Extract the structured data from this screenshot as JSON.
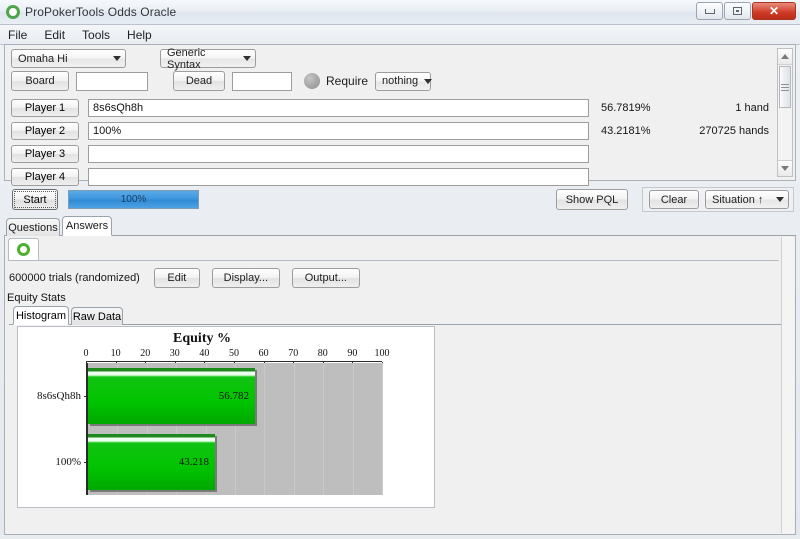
{
  "window": {
    "title": "ProPokerTools Odds Oracle",
    "app_icon": "green-ring-logo-icon",
    "buttons": {
      "minimize": "minimize-icon",
      "maximize": "maximize-icon",
      "close": "✕"
    }
  },
  "menubar": {
    "items": [
      {
        "label": "File"
      },
      {
        "label": "Edit"
      },
      {
        "label": "Tools"
      },
      {
        "label": "Help"
      }
    ]
  },
  "query": {
    "game_select": {
      "value": "Omaha Hi"
    },
    "syntax_select": {
      "value": "Generic Syntax"
    },
    "board_button": "Board",
    "board_value": "",
    "dead_button": "Dead",
    "dead_value": "",
    "require_label": "Require",
    "require_select": {
      "value": "nothing"
    },
    "players": [
      {
        "button": "Player 1",
        "hand": "8s6sQh8h",
        "equity": "56.7819%",
        "hands": "1 hand"
      },
      {
        "button": "Player 2",
        "hand": "100%",
        "equity": "43.2181%",
        "hands": "270725 hands"
      },
      {
        "button": "Player 3",
        "hand": "",
        "equity": "",
        "hands": ""
      },
      {
        "button": "Player 4",
        "hand": "",
        "equity": "",
        "hands": ""
      }
    ]
  },
  "actions": {
    "start_label": "Start",
    "progress_text": "100%",
    "progress_percent": 100,
    "show_pql_label": "Show PQL",
    "clear_label": "Clear",
    "situation_label": "Situation ↑"
  },
  "tabs": {
    "questions": "Questions",
    "answers": "Answers",
    "active": "Answers"
  },
  "answers": {
    "logo_icon": "green-ring-logo-icon",
    "trials_text": "600000 trials (randomized)",
    "edit_label": "Edit",
    "display_label": "Display...",
    "output_label": "Output...",
    "equity_stats_label": "Equity Stats",
    "sub_tabs": {
      "histogram": "Histogram",
      "raw_data": "Raw Data",
      "active": "Histogram"
    }
  },
  "chart_data": {
    "type": "bar",
    "orientation": "horizontal",
    "title": "Equity %",
    "xlabel": "",
    "ylabel": "",
    "xlim": [
      0,
      100
    ],
    "ticks": [
      0,
      10,
      20,
      30,
      40,
      50,
      60,
      70,
      80,
      90,
      100
    ],
    "grid": true,
    "legend": "none",
    "bar_color": "#00c400",
    "track_color": "#bebebe",
    "categories": [
      "8s6sQh8h",
      "100%"
    ],
    "values": [
      56.782,
      43.218
    ],
    "value_labels": [
      "56.782",
      "43.218"
    ]
  }
}
